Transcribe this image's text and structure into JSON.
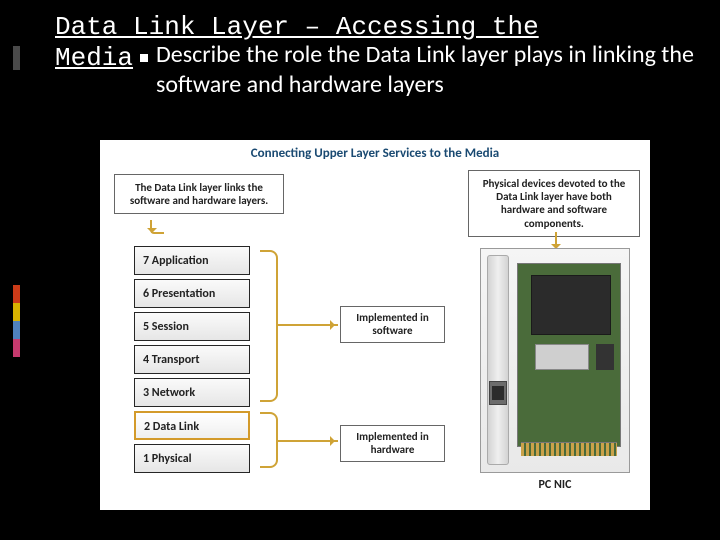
{
  "slide": {
    "title_line1": "Data Link Layer – Accessing the",
    "title_line2": "Media",
    "bullet": "Describe the role the Data Link layer plays in linking the software and hardware layers"
  },
  "diagram": {
    "title": "Connecting Upper Layer Services to the Media",
    "callout_left": "The Data Link layer links the software and hardware layers.",
    "callout_right": "Physical devices devoted to the Data Link layer have both hardware and software components.",
    "osi": [
      "7 Application",
      "6 Presentation",
      "5 Session",
      "4 Transport",
      "3 Network",
      "2 Data Link",
      "1 Physical"
    ],
    "impl_software": "Implemented in software",
    "impl_hardware": "Implemented in hardware",
    "nic_label": "PC NIC"
  }
}
